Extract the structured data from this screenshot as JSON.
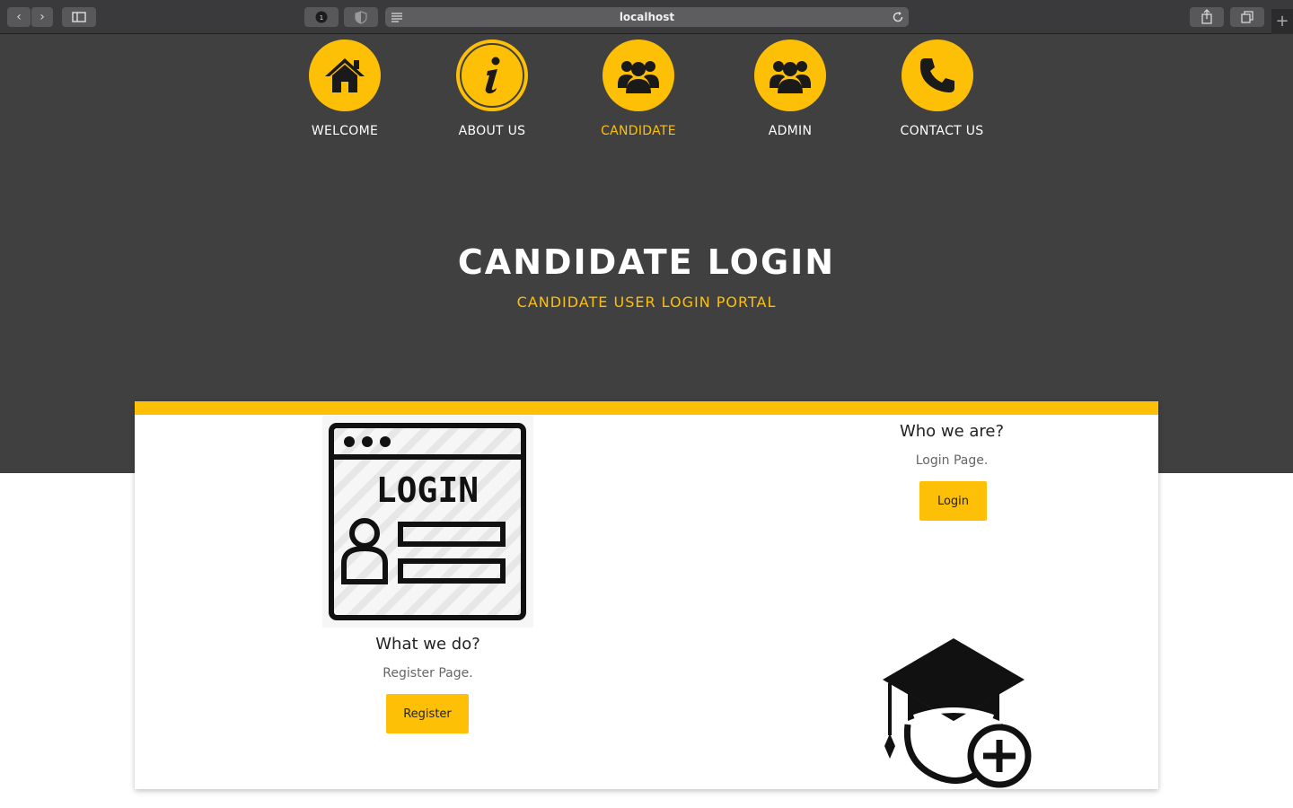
{
  "browser": {
    "url": "localhost",
    "back_glyph": "‹",
    "forward_glyph": "›",
    "new_tab_glyph": "+"
  },
  "nav": {
    "items": [
      {
        "label": "WELCOME",
        "icon": "home-icon"
      },
      {
        "label": "ABOUT US",
        "icon": "info-icon"
      },
      {
        "label": "CANDIDATE",
        "icon": "users-icon"
      },
      {
        "label": "ADMIN",
        "icon": "users-icon"
      },
      {
        "label": "CONTACT US",
        "icon": "phone-icon"
      }
    ],
    "active": "CANDIDATE"
  },
  "hero": {
    "title": "CANDIDATE LOGIN",
    "subtitle": "CANDIDATE USER LOGIN PORTAL"
  },
  "left_section": {
    "illustration_text": "LOGIN",
    "heading": "What we do?",
    "text": "Register Page.",
    "button": "Register"
  },
  "right_section": {
    "heading": "Who we are?",
    "text": "Login Page.",
    "button": "Login"
  },
  "colors": {
    "accent": "#fec006",
    "hero_bg": "#404040"
  }
}
